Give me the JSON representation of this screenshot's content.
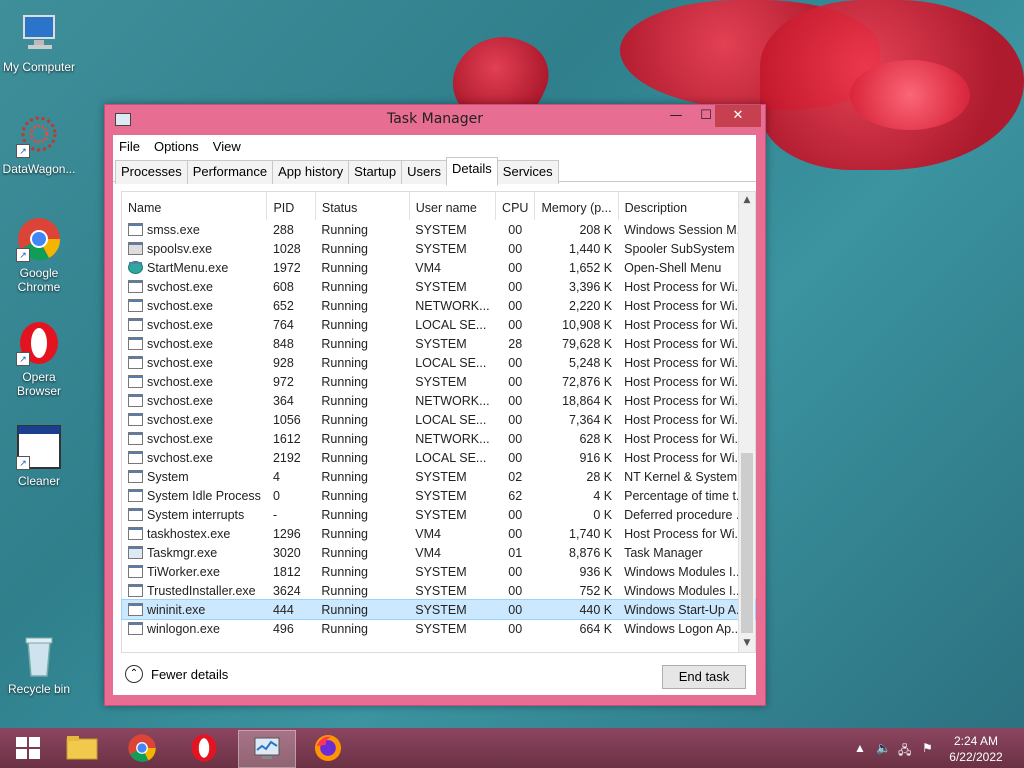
{
  "desktop": {
    "icons": [
      {
        "label": "My Computer"
      },
      {
        "label": "DataWagon..."
      },
      {
        "label": "Google Chrome"
      },
      {
        "label": "Opera Browser"
      },
      {
        "label": "Cleaner"
      },
      {
        "label": "Recycle bin"
      }
    ]
  },
  "window": {
    "title": "Task Manager",
    "controls": {
      "minimize": "—",
      "maximize": "☐",
      "close": "✕"
    },
    "menu": [
      "File",
      "Options",
      "View"
    ],
    "tabs": [
      "Processes",
      "Performance",
      "App history",
      "Startup",
      "Users",
      "Details",
      "Services"
    ],
    "active_tab": "Details",
    "columns": [
      "Name",
      "PID",
      "Status",
      "User name",
      "CPU",
      "Memory (p...",
      "Description"
    ],
    "rows": [
      {
        "name": "smss.exe",
        "pid": "288",
        "status": "Running",
        "user": "SYSTEM",
        "cpu": "00",
        "mem": "208 K",
        "desc": "Windows Session M..."
      },
      {
        "name": "spoolsv.exe",
        "pid": "1028",
        "status": "Running",
        "user": "SYSTEM",
        "cpu": "00",
        "mem": "1,440 K",
        "desc": "Spooler SubSystem ..."
      },
      {
        "name": "StartMenu.exe",
        "pid": "1972",
        "status": "Running",
        "user": "VM4",
        "cpu": "00",
        "mem": "1,652 K",
        "desc": "Open-Shell Menu"
      },
      {
        "name": "svchost.exe",
        "pid": "608",
        "status": "Running",
        "user": "SYSTEM",
        "cpu": "00",
        "mem": "3,396 K",
        "desc": "Host Process for Wi..."
      },
      {
        "name": "svchost.exe",
        "pid": "652",
        "status": "Running",
        "user": "NETWORK...",
        "cpu": "00",
        "mem": "2,220 K",
        "desc": "Host Process for Wi..."
      },
      {
        "name": "svchost.exe",
        "pid": "764",
        "status": "Running",
        "user": "LOCAL SE...",
        "cpu": "00",
        "mem": "10,908 K",
        "desc": "Host Process for Wi..."
      },
      {
        "name": "svchost.exe",
        "pid": "848",
        "status": "Running",
        "user": "SYSTEM",
        "cpu": "28",
        "mem": "79,628 K",
        "desc": "Host Process for Wi..."
      },
      {
        "name": "svchost.exe",
        "pid": "928",
        "status": "Running",
        "user": "LOCAL SE...",
        "cpu": "00",
        "mem": "5,248 K",
        "desc": "Host Process for Wi..."
      },
      {
        "name": "svchost.exe",
        "pid": "972",
        "status": "Running",
        "user": "SYSTEM",
        "cpu": "00",
        "mem": "72,876 K",
        "desc": "Host Process for Wi..."
      },
      {
        "name": "svchost.exe",
        "pid": "364",
        "status": "Running",
        "user": "NETWORK...",
        "cpu": "00",
        "mem": "18,864 K",
        "desc": "Host Process for Wi..."
      },
      {
        "name": "svchost.exe",
        "pid": "1056",
        "status": "Running",
        "user": "LOCAL SE...",
        "cpu": "00",
        "mem": "7,364 K",
        "desc": "Host Process for Wi..."
      },
      {
        "name": "svchost.exe",
        "pid": "1612",
        "status": "Running",
        "user": "NETWORK...",
        "cpu": "00",
        "mem": "628 K",
        "desc": "Host Process for Wi..."
      },
      {
        "name": "svchost.exe",
        "pid": "2192",
        "status": "Running",
        "user": "LOCAL SE...",
        "cpu": "00",
        "mem": "916 K",
        "desc": "Host Process for Wi..."
      },
      {
        "name": "System",
        "pid": "4",
        "status": "Running",
        "user": "SYSTEM",
        "cpu": "02",
        "mem": "28 K",
        "desc": "NT Kernel & System"
      },
      {
        "name": "System Idle Process",
        "pid": "0",
        "status": "Running",
        "user": "SYSTEM",
        "cpu": "62",
        "mem": "4 K",
        "desc": "Percentage of time t..."
      },
      {
        "name": "System interrupts",
        "pid": "-",
        "status": "Running",
        "user": "SYSTEM",
        "cpu": "00",
        "mem": "0 K",
        "desc": "Deferred procedure ..."
      },
      {
        "name": "taskhostex.exe",
        "pid": "1296",
        "status": "Running",
        "user": "VM4",
        "cpu": "00",
        "mem": "1,740 K",
        "desc": "Host Process for Wi..."
      },
      {
        "name": "Taskmgr.exe",
        "pid": "3020",
        "status": "Running",
        "user": "VM4",
        "cpu": "01",
        "mem": "8,876 K",
        "desc": "Task Manager"
      },
      {
        "name": "TiWorker.exe",
        "pid": "1812",
        "status": "Running",
        "user": "SYSTEM",
        "cpu": "00",
        "mem": "936 K",
        "desc": "Windows Modules I..."
      },
      {
        "name": "TrustedInstaller.exe",
        "pid": "3624",
        "status": "Running",
        "user": "SYSTEM",
        "cpu": "00",
        "mem": "752 K",
        "desc": "Windows Modules I..."
      },
      {
        "name": "wininit.exe",
        "pid": "444",
        "status": "Running",
        "user": "SYSTEM",
        "cpu": "00",
        "mem": "440 K",
        "desc": "Windows Start-Up A..."
      },
      {
        "name": "winlogon.exe",
        "pid": "496",
        "status": "Running",
        "user": "SYSTEM",
        "cpu": "00",
        "mem": "664 K",
        "desc": "Windows Logon Ap..."
      }
    ],
    "selected_row": "wininit.exe",
    "fewer_details": "Fewer details",
    "end_task": "End task"
  },
  "taskbar": {
    "items": [
      "start-button",
      "file-explorer",
      "google-chrome",
      "opera",
      "task-manager",
      "firefox"
    ],
    "active": "task-manager",
    "time": "2:24 AM",
    "date": "6/22/2022"
  },
  "colors": {
    "window_frame": "#e86d93",
    "close_button": "#c7404f",
    "selection": "#cce8ff",
    "taskbar": "#7a3c4f"
  }
}
